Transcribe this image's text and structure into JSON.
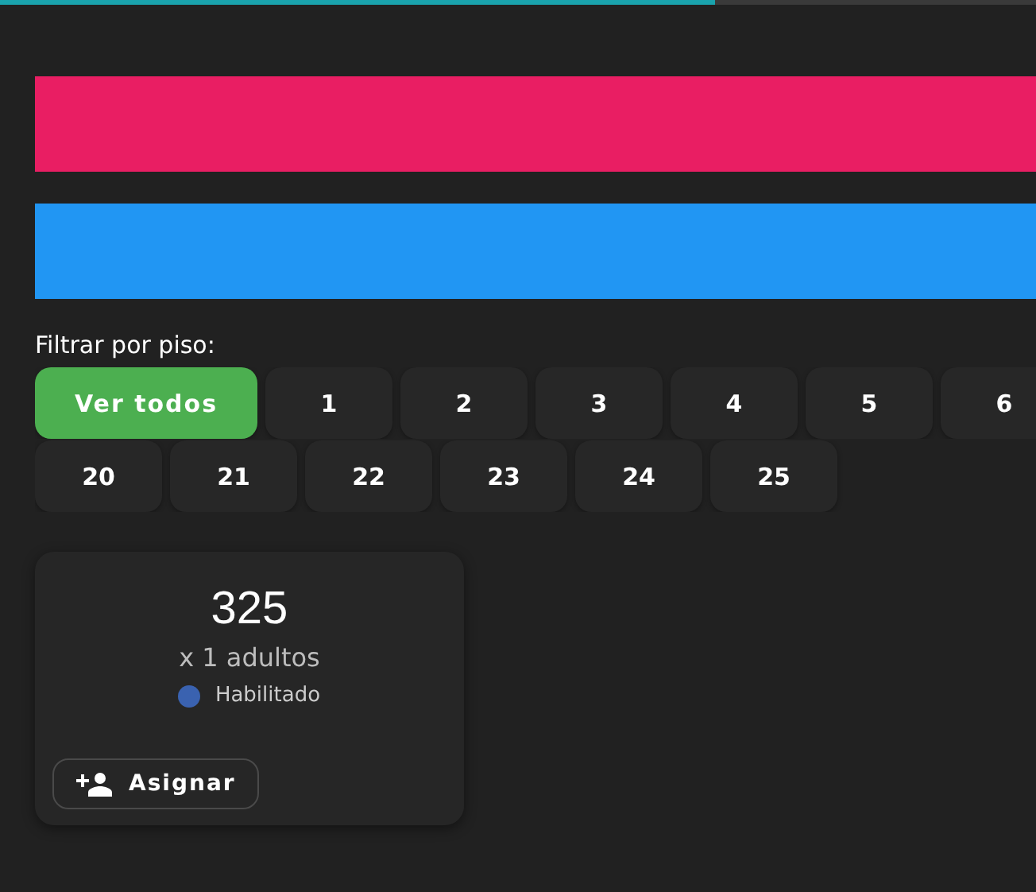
{
  "progress": {
    "level": 0.69
  },
  "banners": [
    {
      "color": "#e91e63"
    },
    {
      "color": "#2196f3"
    }
  ],
  "floor_filter": {
    "label": "Filtrar por piso:",
    "rows": [
      [
        {
          "label": "Ver todos",
          "selected": true
        },
        {
          "label": "1",
          "selected": false
        },
        {
          "label": "2",
          "selected": false
        },
        {
          "label": "3",
          "selected": false
        },
        {
          "label": "4",
          "selected": false
        },
        {
          "label": "5",
          "selected": false
        },
        {
          "label": "6",
          "selected": false
        }
      ],
      [
        {
          "label": "20",
          "selected": false
        },
        {
          "label": "21",
          "selected": false
        },
        {
          "label": "22",
          "selected": false
        },
        {
          "label": "23",
          "selected": false
        },
        {
          "label": "24",
          "selected": false
        },
        {
          "label": "25",
          "selected": false
        }
      ]
    ]
  },
  "rooms": [
    {
      "number": "325",
      "occupancy": "x 1 adultos",
      "status": "Habilitado",
      "color": "#3a62b0",
      "button": "Asignar"
    }
  ]
}
